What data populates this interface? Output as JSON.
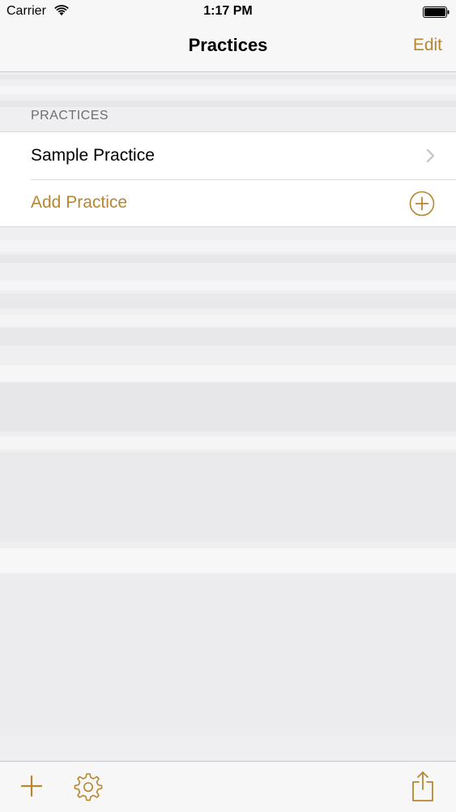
{
  "status_bar": {
    "carrier": "Carrier",
    "time": "1:17 PM",
    "wifi_icon": "wifi-icon",
    "battery_icon": "battery-icon"
  },
  "nav": {
    "title": "Practices",
    "edit_label": "Edit"
  },
  "section": {
    "header": "PRACTICES",
    "rows": [
      {
        "label": "Sample Practice",
        "accessory": "chevron-right-icon"
      },
      {
        "label": "Add Practice",
        "accessory": "add-circle-icon"
      }
    ]
  },
  "toolbar": {
    "items": [
      "plus-icon",
      "gear-icon",
      "share-icon"
    ]
  },
  "colors": {
    "accent": "#b8862f",
    "background": "#efeff1",
    "bar": "#f7f7f7"
  }
}
